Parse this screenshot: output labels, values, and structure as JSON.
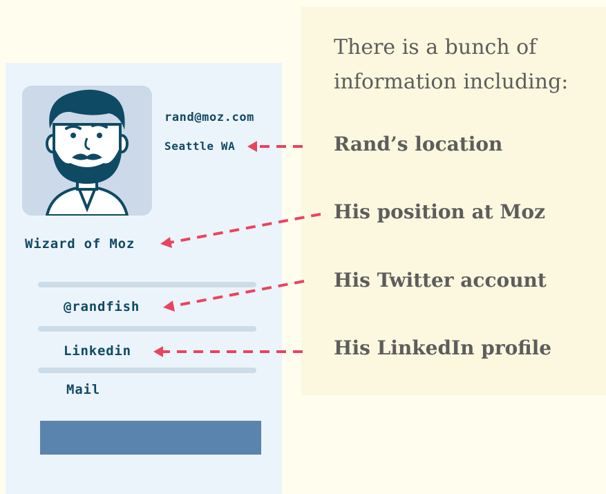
{
  "card": {
    "email": "rand@moz.com",
    "location": "Seattle WA",
    "position": "Wizard of Moz",
    "twitter": "@randfish",
    "linkedin": "Linkedin",
    "mail": "Mail"
  },
  "panel": {
    "intro_line1": "There is a bunch of",
    "intro_line2": "information including:",
    "labels": [
      "Rand’s location",
      "His position at Moz",
      "His Twitter account",
      "His LinkedIn profile"
    ]
  },
  "colors": {
    "background": "#fefdee",
    "card": "#ecf4fb",
    "panel": "#fbf8df",
    "arrow": "#e8445e",
    "card_text": "#0e4a63",
    "panel_text": "#5d5d5d",
    "button": "#5a84ae"
  },
  "icons": {
    "avatar": "bearded-man-avatar-icon",
    "arrow": "dashed-arrow-icon"
  }
}
